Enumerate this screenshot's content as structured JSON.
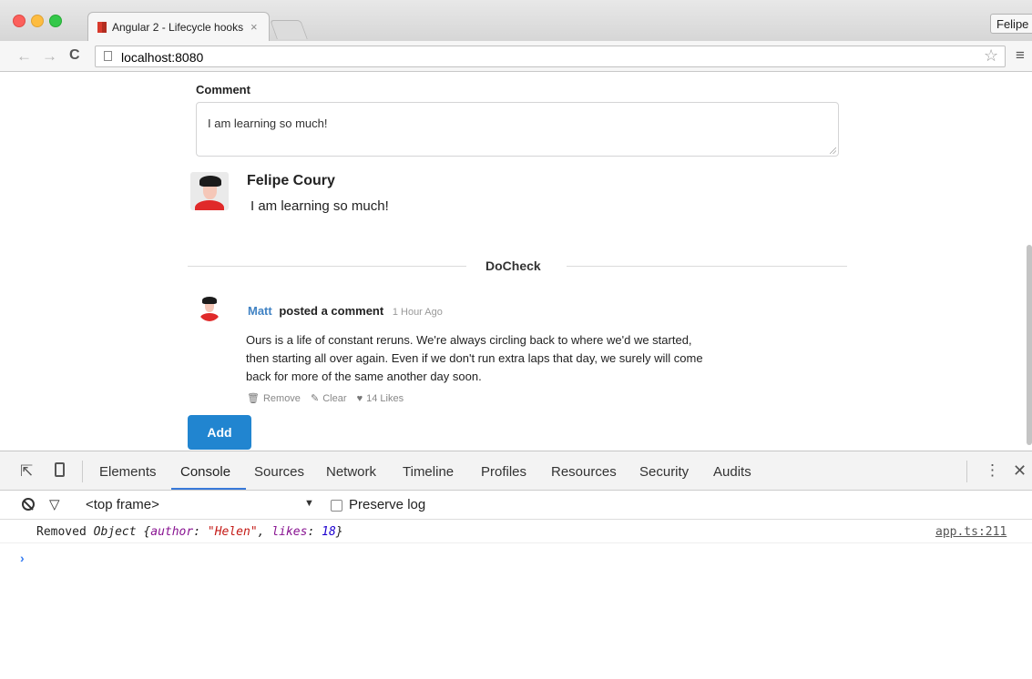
{
  "browser": {
    "tab_title": "Angular 2 - Lifecycle hooks",
    "tab_close": "×",
    "profile_name": "Felipe",
    "url": "localhost:8080",
    "back_glyph": "←",
    "forward_glyph": "→",
    "reload_glyph": "C",
    "star_glyph": "☆",
    "menu_glyph": "≡"
  },
  "page": {
    "comment_label": "Comment",
    "comment_value": "I am learning so much!",
    "preview": {
      "author": "Felipe Coury",
      "text": "I am learning so much!"
    },
    "section_title": "DoCheck",
    "comment": {
      "author": "Matt",
      "action": "posted a comment",
      "date": "1 Hour Ago",
      "text": "Ours is a life of constant reruns. We're always circling back to where we'd we started, then starting all over again. Even if we don't run extra laps that day, we surely will come back for more of the same another day soon.",
      "remove_label": "Remove",
      "clear_label": "Clear",
      "likes_label": "14 Likes"
    },
    "add_button": "Add"
  },
  "devtools": {
    "tabs": [
      "Elements",
      "Console",
      "Sources",
      "Network",
      "Timeline",
      "Profiles",
      "Resources",
      "Security",
      "Audits"
    ],
    "active_tab": "Console",
    "frame": "<top frame>",
    "frame_arrow": "▼",
    "preserve_log": "Preserve log",
    "kebab_glyph": "⋮",
    "close_glyph": "✕",
    "filter_glyph": "▽",
    "inspect_glyph": "⇱",
    "log": {
      "prefix": "Removed ",
      "object_word": "Object ",
      "brace_open": "{",
      "key1": "author",
      "sep1": ": ",
      "val1": "\"Helen\"",
      "comma": ", ",
      "key2": "likes",
      "sep2": ": ",
      "val2": "18",
      "brace_close": "}",
      "source": "app.ts:211"
    },
    "prompt": "›"
  },
  "colors": {
    "accent_blue": "#2185d0",
    "link_blue": "#4183c4",
    "devtools_active": "#3879d9"
  }
}
